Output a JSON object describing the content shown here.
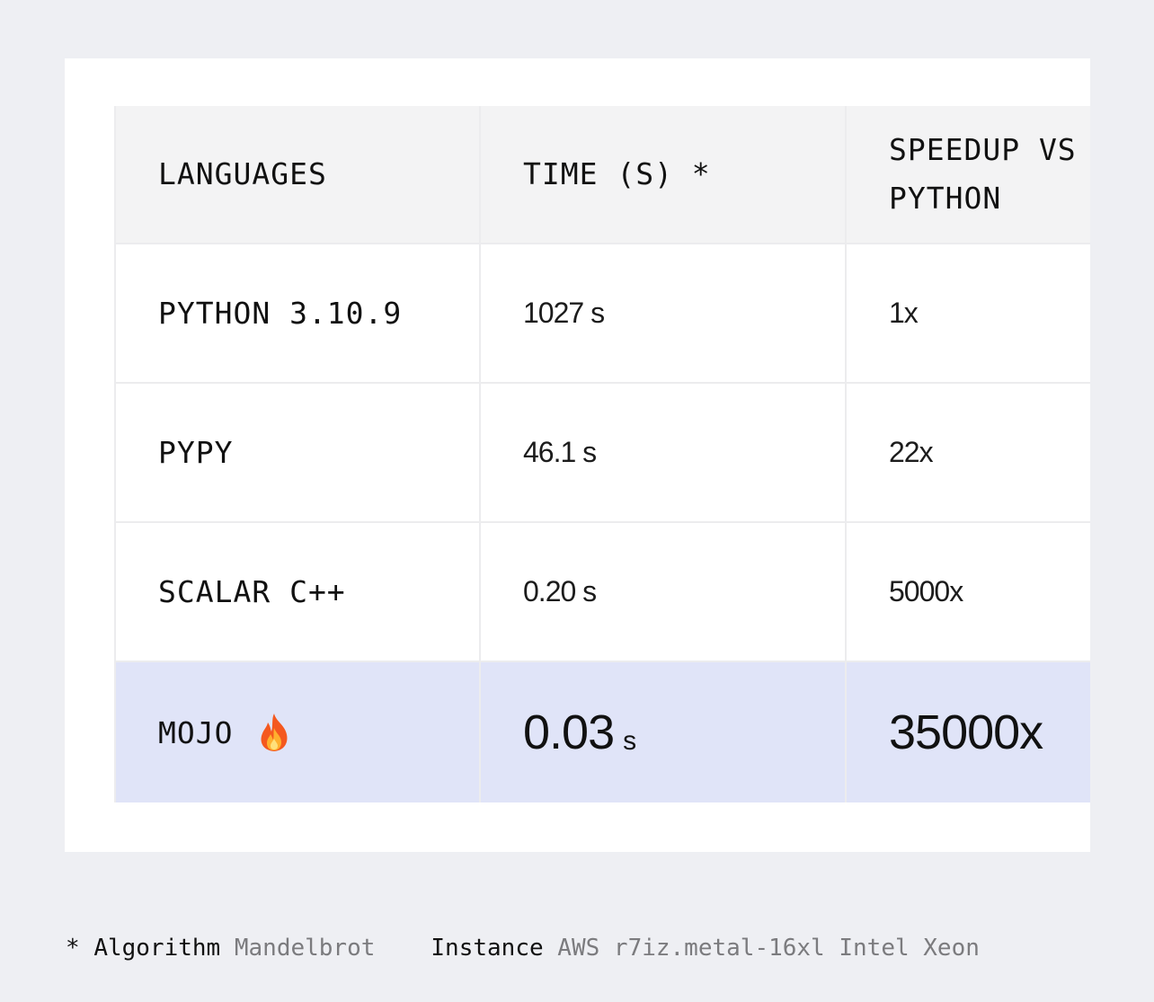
{
  "table": {
    "headers": [
      "LANGUAGES",
      "TIME (S) *",
      "SPEEDUP VS PYTHON"
    ],
    "rows": [
      {
        "language": "PYTHON 3.10.9",
        "time": "1027 s",
        "speedup": "1x"
      },
      {
        "language": "PYPY",
        "time": "46.1 s",
        "speedup": "22x"
      },
      {
        "language": "SCALAR C++",
        "time": "0.20 s",
        "speedup": "5000x"
      }
    ],
    "highlight": {
      "language": "MOJO",
      "language_icon": "fire-icon",
      "time_value": "0.03",
      "time_unit": "s",
      "speedup": "35000x",
      "row_color": "#e0e4f8"
    }
  },
  "footer": {
    "algorithm_label": "Algorithm",
    "algorithm_value": "Mandelbrot",
    "instance_label": "Instance",
    "instance_value": "AWS r7iz.metal-16xl Intel Xeon"
  }
}
